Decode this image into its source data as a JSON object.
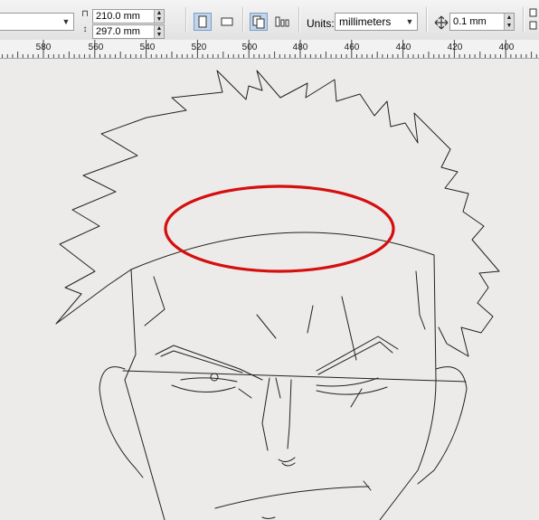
{
  "toolbar": {
    "paper_type_value": "",
    "width_value": "210.0 mm",
    "height_value": "297.0 mm",
    "units_label": "Units:",
    "units_value": "millimeters",
    "nudge_value": "0.1 mm"
  },
  "ruler": {
    "labels": [
      "580",
      "560",
      "540",
      "520",
      "500",
      "480",
      "460",
      "440",
      "420",
      "400"
    ]
  },
  "colors": {
    "toolbar_bg": "#e8e8e8",
    "canvas_bg": "#ecebe9",
    "highlight_ellipse": "#d40f0f",
    "active_button": "#c2d4ec"
  },
  "icons": [
    "width-icon",
    "height-icon",
    "portrait-icon",
    "landscape-icon",
    "all-pages-icon",
    "current-page-icon",
    "nudge-icon"
  ]
}
